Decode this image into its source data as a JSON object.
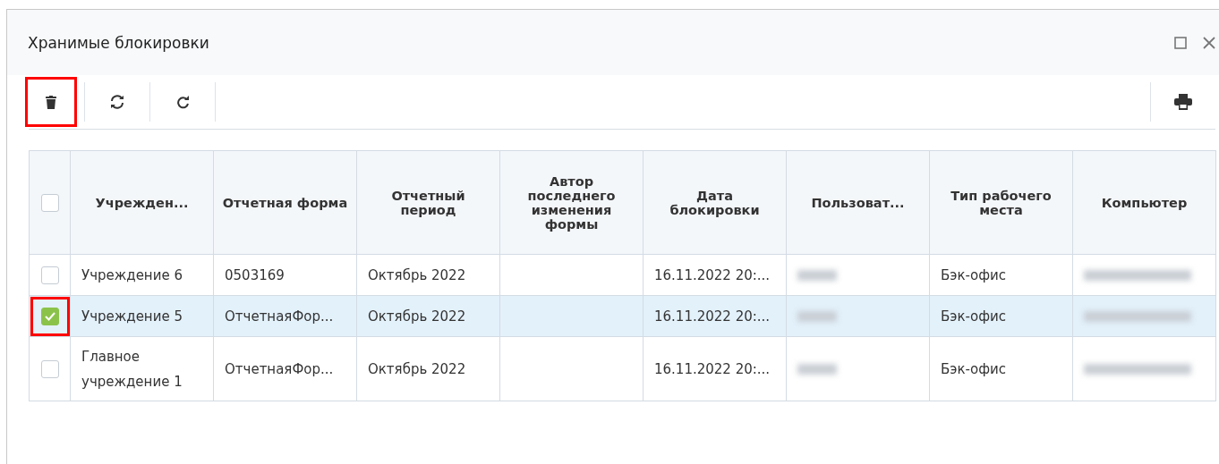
{
  "window": {
    "title": "Хранимые блокировки"
  },
  "toolbar": [
    {
      "kind": "delete",
      "highlighted": true
    },
    {
      "kind": "sync",
      "highlighted": false
    },
    {
      "kind": "refresh",
      "highlighted": false
    }
  ],
  "toolbar_right": [
    {
      "kind": "print",
      "highlighted": false
    }
  ],
  "table": {
    "select_all_checked": false,
    "columns": [
      "Учрежден...",
      "Отчетная форма",
      "Отчетный период",
      "Автор последнего изменения формы",
      "Дата блокировки",
      "Пользоват...",
      "Тип рабочего места",
      "Компьютер"
    ],
    "rows": [
      {
        "selected": false,
        "checkbox_highlighted": false,
        "cells": [
          "Учреждение 6",
          "0503169",
          "Октябрь 2022",
          "",
          "16.11.2022 20:...",
          null,
          "Бэк-офис",
          null
        ]
      },
      {
        "selected": true,
        "checkbox_highlighted": true,
        "cells": [
          "Учреждение 5",
          "ОтчетнаяФор...",
          "Октябрь 2022",
          "",
          "16.11.2022 20:...",
          null,
          "Бэк-офис",
          null
        ]
      },
      {
        "selected": false,
        "checkbox_highlighted": false,
        "cells": [
          "Главное учреждение 1",
          "ОтчетнаяФор...",
          "Октябрь 2022",
          "",
          "16.11.2022 20:...",
          null,
          "Бэк-офис",
          null
        ]
      }
    ]
  }
}
